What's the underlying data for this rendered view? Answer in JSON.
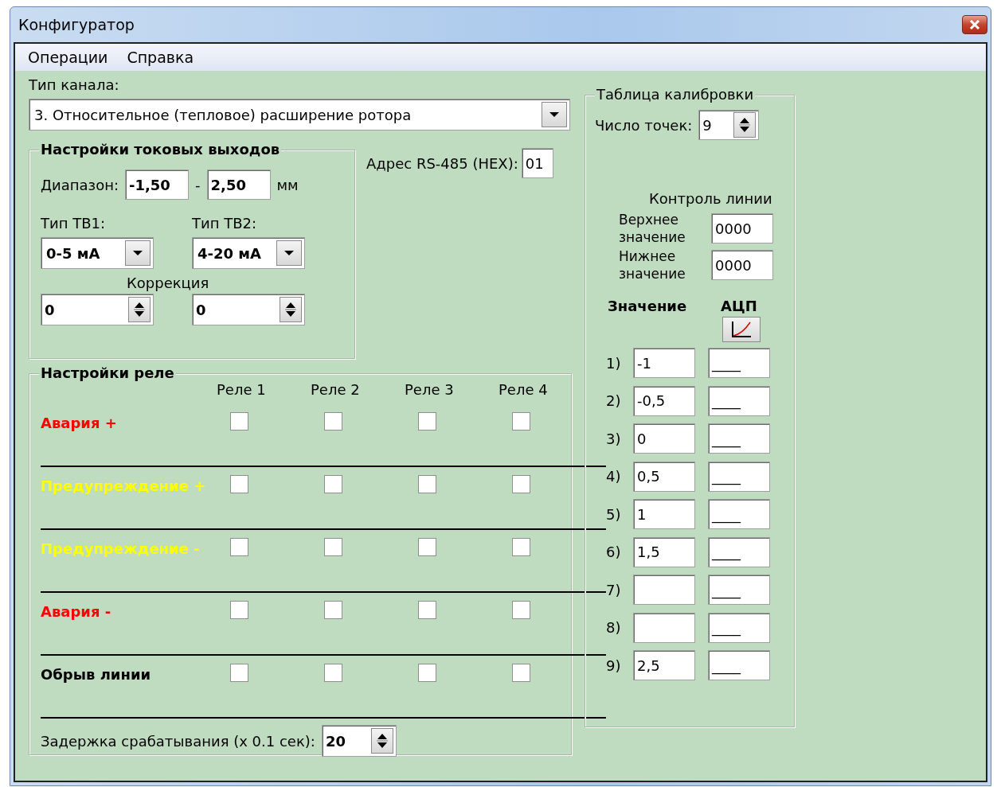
{
  "window": {
    "title": "Конфигуратор"
  },
  "menu": [
    {
      "label": "Операции"
    },
    {
      "label": "Справка"
    }
  ],
  "channel_type": {
    "label": "Тип канала:",
    "value": "3. Относительное (тепловое) расширение ротора"
  },
  "current_outputs": {
    "title": "Настройки токовых выходов",
    "range_label": "Диапазон:",
    "range_from": "-1,50",
    "range_separator": "-",
    "range_to": "2,50",
    "unit": "мм",
    "correction_label": "Коррекция",
    "outputs": [
      {
        "label": "Тип ТВ1:",
        "type": "0-5 мА",
        "correction": "0"
      },
      {
        "label": "Тип ТВ2:",
        "type": "4-20 мА",
        "correction": "0"
      }
    ]
  },
  "rs485": {
    "label": "Адрес RS-485 (HEX):",
    "value": "01"
  },
  "relays": {
    "title": "Настройки реле",
    "columns": [
      "Реле 1",
      "Реле 2",
      "Реле 3",
      "Реле 4"
    ],
    "rows": [
      {
        "label": "Авария +",
        "color": "#ff0000",
        "checked": [
          false,
          false,
          false,
          false
        ]
      },
      {
        "label": "Предупреждение +",
        "color": "#ffff00",
        "checked": [
          false,
          false,
          false,
          false
        ]
      },
      {
        "label": "Предупреждение -",
        "color": "#ffff00",
        "checked": [
          false,
          false,
          false,
          false
        ]
      },
      {
        "label": "Авария -",
        "color": "#ff0000",
        "checked": [
          false,
          false,
          false,
          false
        ]
      },
      {
        "label": "Обрыв линии",
        "color": "#000000",
        "checked": [
          false,
          false,
          false,
          false
        ]
      }
    ],
    "delay_label": "Задержка срабатывания (x 0.1 сек):",
    "delay": "20"
  },
  "calibration": {
    "title": "Таблица калибровки",
    "points_label": "Число точек:",
    "points": "9",
    "line_control_label": "Контроль линии",
    "upper_label": "Верхнее значение",
    "upper": "0000",
    "lower_label": "Нижнее значение",
    "lower": "0000",
    "value_header": "Значение",
    "adc_header": "АЦП",
    "rows": [
      {
        "index": "1)",
        "value": "-1",
        "adc": "____"
      },
      {
        "index": "2)",
        "value": "-0,5",
        "adc": "____"
      },
      {
        "index": "3)",
        "value": "0",
        "adc": "____"
      },
      {
        "index": "4)",
        "value": "0,5",
        "adc": "____"
      },
      {
        "index": "5)",
        "value": "1",
        "adc": "____"
      },
      {
        "index": "6)",
        "value": "1,5",
        "adc": "____"
      },
      {
        "index": "7)",
        "adc": "____"
      },
      {
        "index": "8)",
        "adc": "____"
      },
      {
        "index": "9)",
        "value": "2,5",
        "adc": "____"
      }
    ]
  }
}
